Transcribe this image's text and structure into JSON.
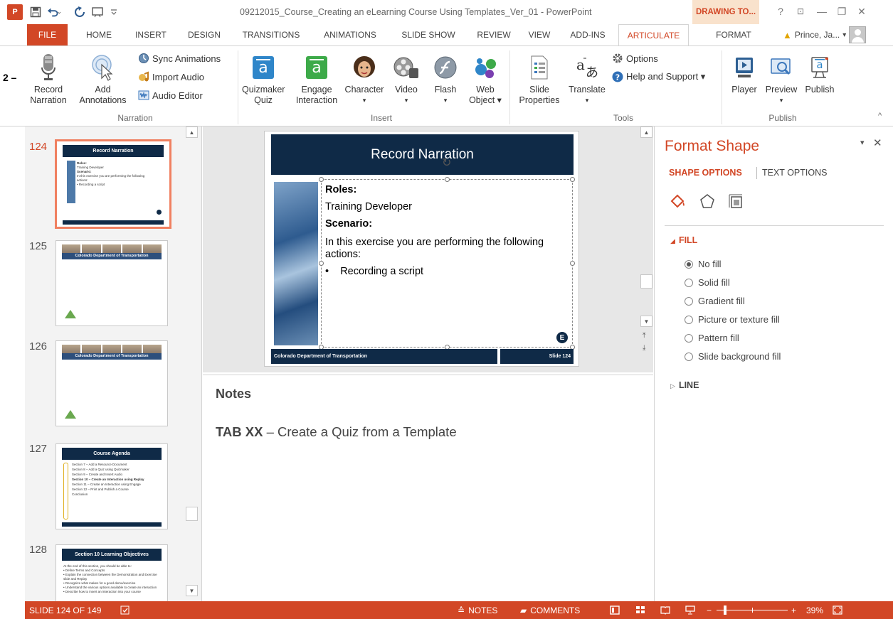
{
  "titlebar": {
    "app_logo": "P",
    "document_title": "09212015_Course_Creating an eLearning Course Using Templates_Ver_01 - PowerPoint",
    "contextual_tab": "DRAWING TO...",
    "help": "?",
    "restore_ribbon": "⊡",
    "minimize": "—",
    "maximize": "❐",
    "close": "✕"
  },
  "tabs": {
    "file": "FILE",
    "home": "HOME",
    "insert": "INSERT",
    "design": "DESIGN",
    "transitions": "TRANSITIONS",
    "animations": "ANIMATIONS",
    "slideshow": "SLIDE SHOW",
    "review": "REVIEW",
    "view": "VIEW",
    "addins": "ADD-INS",
    "articulate": "ARTICULATE",
    "format": "FORMAT"
  },
  "user": {
    "name": "Prince, Ja...",
    "dropdown": "▾"
  },
  "ribbon": {
    "keytip": "2 –",
    "narration": {
      "record": "Record\nNarration",
      "record_line1": "Record",
      "record_line2": "Narration",
      "add_line1": "Add",
      "add_line2": "Annotations",
      "sync": "Sync Animations",
      "import": "Import Audio",
      "editor": "Audio Editor",
      "group_label": "Narration"
    },
    "insert": {
      "quizmaker_1": "Quizmaker",
      "quizmaker_2": "Quiz",
      "engage_1": "Engage",
      "engage_2": "Interaction",
      "character": "Character",
      "video": "Video",
      "flash": "Flash",
      "web_1": "Web",
      "web_2": "Object ▾",
      "dropdown": "▾",
      "group_label": "Insert"
    },
    "tools": {
      "slideprops_1": "Slide",
      "slideprops_2": "Properties",
      "translate": "Translate",
      "translate_dd": "▾",
      "options": "Options",
      "help": "Help and Support ▾",
      "group_label": "Tools"
    },
    "publish": {
      "player": "Player",
      "preview": "Preview",
      "preview_dd": "▾",
      "publish": "Publish",
      "group_label": "Publish"
    },
    "collapse": "^"
  },
  "thumbnails": [
    {
      "number": "124",
      "title": "Record Narration",
      "lines": [
        "Roles:",
        "Training Developer",
        "Scenario:",
        "In this exercise you are performing the following",
        "actions:",
        "•  Recording a script"
      ]
    },
    {
      "number": "125",
      "band": "Colorado Department of Transportation"
    },
    {
      "number": "126",
      "band": "Colorado Department of Transportation"
    },
    {
      "number": "127",
      "title": "Course Agenda",
      "lines": [
        "Section 7 – Add a Resource Document",
        "Section 8 – Add a Quiz using Quizmaker",
        "Section 9 – Create and Insert Audio",
        "Section 10 – Create an Interaction using Replay",
        "Section 11 – Create an Interaction using Engage",
        "Section 12 – Print and Publish a Course",
        "Conclusion"
      ]
    },
    {
      "number": "128",
      "title": "Section 10 Learning Objectives",
      "lines": [
        "At the end of this section, you should be able to:",
        "•  Define Terms and Concepts",
        "•  Explain the connection between the Demonstration and Exercise",
        "    slide and Replay",
        "•  Recognize what makes for a good demo/exercise",
        "•  Understand the various options available to create an interaction",
        "•  Describe how to insert an interaction into your course"
      ]
    }
  ],
  "slide": {
    "title": "Record Narration",
    "roles_label": "Roles:",
    "roles_value": "Training Developer",
    "scenario_label": "Scenario:",
    "scenario_text_1": "In this exercise you are performing the following",
    "scenario_text_2": "actions:",
    "bullet": "Recording a script",
    "footer_left": "Colorado Department of Transportation",
    "footer_right": "Slide 124",
    "badge": "E"
  },
  "notes": {
    "heading": "Notes",
    "body_bold": "TAB XX",
    "body_rest": " – Create a Quiz from a Template"
  },
  "format_shape": {
    "title": "Format Shape",
    "tab_shape": "SHAPE OPTIONS",
    "tab_text": "TEXT OPTIONS",
    "fill_section": "FILL",
    "line_section": "LINE",
    "fill_options": [
      {
        "label": "No fill",
        "checked": true
      },
      {
        "label": "Solid fill",
        "checked": false
      },
      {
        "label": "Gradient fill",
        "checked": false
      },
      {
        "label": "Picture or texture fill",
        "checked": false
      },
      {
        "label": "Pattern fill",
        "checked": false
      },
      {
        "label": "Slide background fill",
        "checked": false
      }
    ]
  },
  "statusbar": {
    "slide_info": "SLIDE 124 OF 149",
    "notes": "NOTES",
    "comments": "COMMENTS",
    "zoom": "39%"
  },
  "colors": {
    "accent": "#d24726",
    "slide_navy": "#0f2a47"
  }
}
